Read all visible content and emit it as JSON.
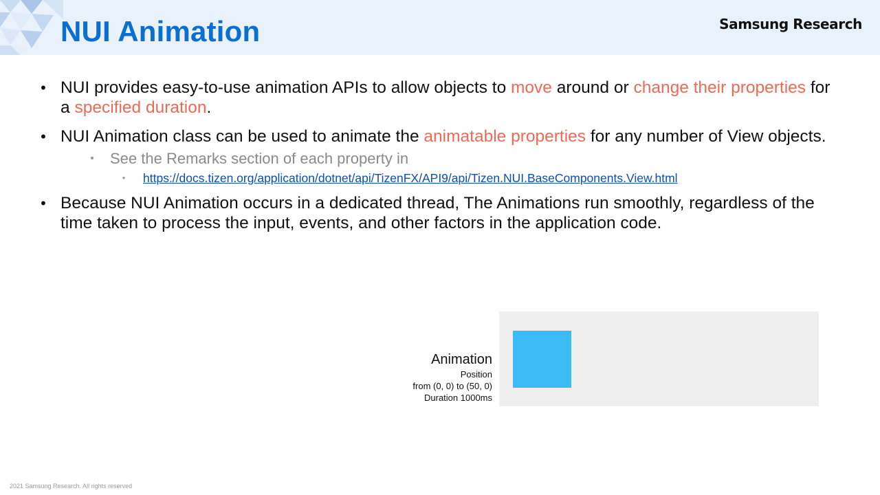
{
  "header": {
    "title": "NUI Animation",
    "brand": "Samsung Research",
    "background_color": "#e9f1fb",
    "title_color": "#0a6fd1"
  },
  "bullets": [
    {
      "segments": [
        {
          "text": "NUI provides easy-to-use animation APIs to allow objects to ",
          "highlight": false
        },
        {
          "text": "move",
          "highlight": true
        },
        {
          "text": " around or ",
          "highlight": false
        },
        {
          "text": "change their properties",
          "highlight": true
        },
        {
          "text": " for a ",
          "highlight": false
        },
        {
          "text": "specified duration",
          "highlight": true
        },
        {
          "text": ".",
          "highlight": false
        }
      ]
    },
    {
      "segments": [
        {
          "text": "NUI Animation class can be used to animate the ",
          "highlight": false
        },
        {
          "text": "animatable properties",
          "highlight": true
        },
        {
          "text": " for any number of View objects.",
          "highlight": false
        }
      ],
      "sub": {
        "text": "See the Remarks section of each property in",
        "link": "https://docs.tizen.org/application/dotnet/api/TizenFX/API9/api/Tizen.NUI.BaseComponents.View.html"
      }
    },
    {
      "segments": [
        {
          "text": "Because NUI Animation occurs in a dedicated thread, The Animations run smoothly, regardless of the time taken to process the input, events, and other factors in the application code.",
          "highlight": false
        }
      ]
    }
  ],
  "bullet_glyph": "•",
  "highlight_color": "#ee6a55",
  "demo": {
    "heading": "Animation",
    "line1": "Position",
    "line2": "from (0, 0) to (50, 0)",
    "line3": "Duration 1000ms",
    "stage_color": "#efefef",
    "box_color": "#3bbcf5"
  },
  "footer": "2021 Samsung Research. All rights reserved"
}
